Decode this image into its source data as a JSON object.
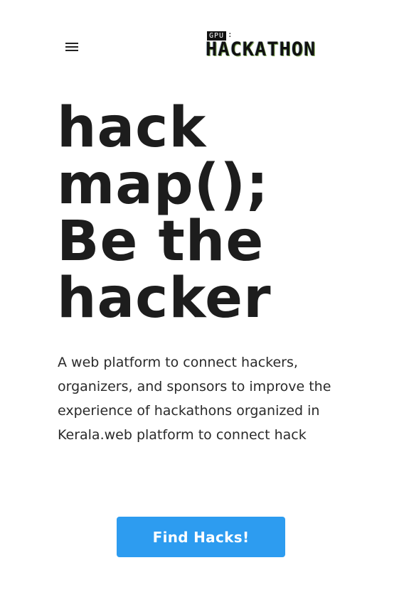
{
  "header": {
    "menu_icon": "hamburger-menu-icon",
    "logo": {
      "badge": "GPU",
      "separator": ":",
      "word": "HACKATHON"
    }
  },
  "hero": {
    "headline_lines": [
      "hack",
      "map();",
      "Be the",
      "hacker"
    ],
    "description": "A web platform to connect hackers, organizers, and sponsors to improve the experience of hackathons organized in Kerala.web platform to connect hack",
    "cta_label": "Find Hacks!"
  },
  "colors": {
    "accent": "#2d9cf0",
    "text": "#1d1d1d",
    "background": "#ffffff"
  }
}
